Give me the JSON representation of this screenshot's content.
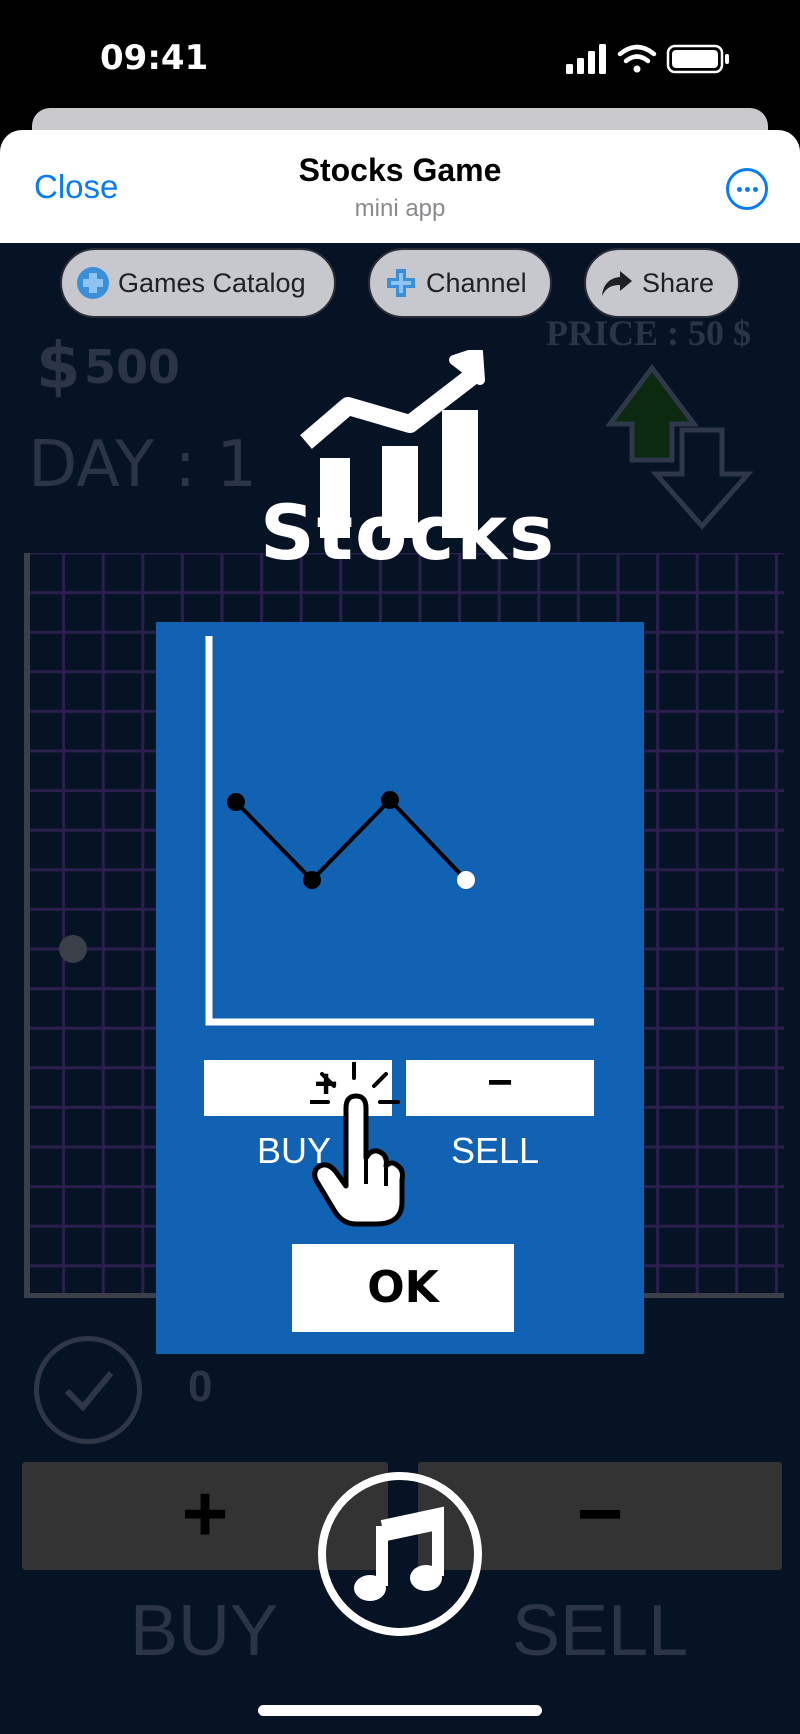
{
  "status_bar": {
    "time": "09:41",
    "icons": [
      "signal-icon",
      "wifi-icon",
      "battery-icon"
    ]
  },
  "header": {
    "close_label": "Close",
    "title": "Stocks Game",
    "subtitle": "mini app",
    "more_icon": "more-icon"
  },
  "top_buttons": [
    {
      "label": "Games Catalog",
      "icon": "gamepad-icon"
    },
    {
      "label": "Channel",
      "icon": "gamepad-icon"
    },
    {
      "label": "Share",
      "icon": "share-arrow-icon"
    }
  ],
  "game": {
    "money_symbol": "$",
    "money": "500",
    "day": "DAY : 1",
    "price": "PRICE : 50  $",
    "shares": "0",
    "buy_symbol": "+",
    "sell_symbol": "−",
    "buy_label": "BUY",
    "sell_label": "SELL",
    "logo_text": "Stocks"
  },
  "dialog": {
    "buy_symbol": "+",
    "sell_symbol": "−",
    "buy_label": "BUY",
    "sell_label": "SELL",
    "ok_label": "OK"
  },
  "colors": {
    "accent": "#0a7cf0",
    "game_bg": "#061325",
    "dialog_bg": "#1262b3",
    "grid_line": "#2a1f4d"
  }
}
